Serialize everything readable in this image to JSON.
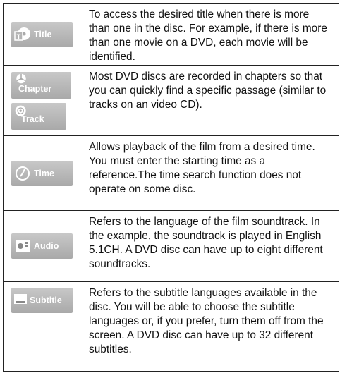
{
  "rows": [
    {
      "label": "Title",
      "icon": "title-disc-icon",
      "text": "To access the desired title when there is more than one in the disc. For example, if there is more than one movie on a DVD, each movie will be identified."
    },
    {
      "label": "Chapter",
      "label2": "Track",
      "icon": "chapter-icon",
      "icon2": "track-icon",
      "text": "Most DVD discs are recorded in chapters so that you can quickly find a specific passage (similar to tracks on an video CD)."
    },
    {
      "label": "Time",
      "icon": "clock-icon",
      "text": "Allows playback of the film from a desired time. You must enter the starting time as a reference.The time search function does not operate on some disc."
    },
    {
      "label": "Audio",
      "icon": "audio-icon",
      "text": "Refers to the language of the film soundtrack. In the example, the soundtrack is played in English 5.1CH. A DVD disc can have up to eight different soundtracks."
    },
    {
      "label": "Subtitle",
      "icon": "subtitle-icon",
      "text": "Refers to the subtitle languages available in the disc. You will be able to choose the subtitle languages or, if you prefer, turn them off from the screen. A DVD disc can have up to 32 different subtitles."
    }
  ]
}
